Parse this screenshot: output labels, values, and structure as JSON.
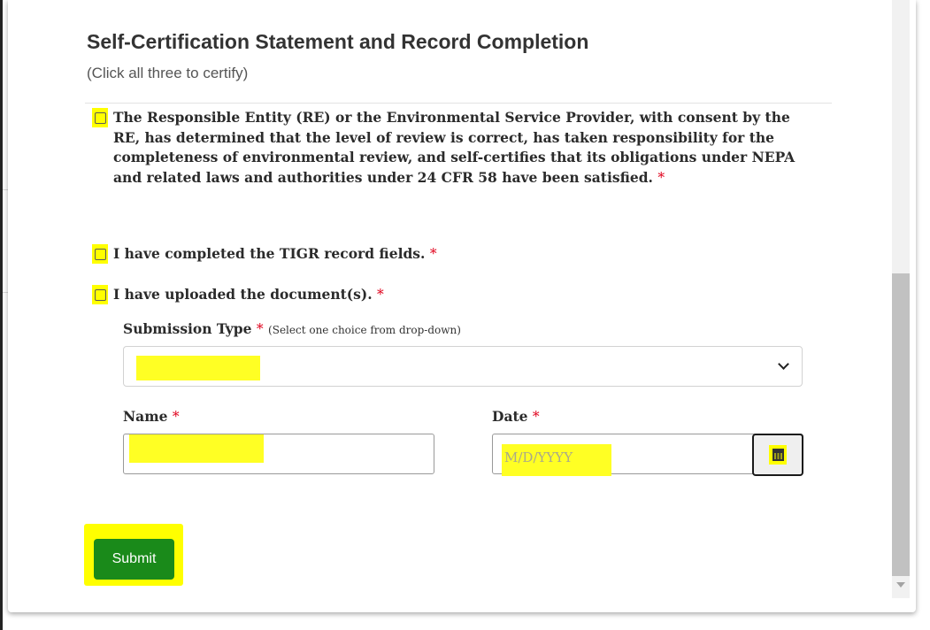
{
  "dialog": {
    "title": "Self-Certification Statement and Record Completion",
    "subtitle": "(Click all three to certify)"
  },
  "certifications": [
    {
      "text": "The Responsible Entity (RE) or the Environmental Service Provider, with consent by the RE, has determined that the level of review is correct, has taken responsibility for the completeness of environmental review, and self-certifies that its obligations under NEPA and related laws and authorities under 24 CFR 58 have been satisfied.",
      "required_mark": "*",
      "checked": false
    },
    {
      "text": "I have completed the TIGR record fields.",
      "required_mark": "*",
      "checked": false
    },
    {
      "text": "I have uploaded the document(s).",
      "required_mark": "*",
      "checked": false
    }
  ],
  "form": {
    "submission_type": {
      "label": "Submission Type",
      "required_mark": "*",
      "hint": "(Select one choice from drop-down)",
      "value": ""
    },
    "name": {
      "label": "Name",
      "required_mark": "*",
      "value": ""
    },
    "date": {
      "label": "Date",
      "required_mark": "*",
      "placeholder": "M/D/YYYY",
      "value": ""
    },
    "submit_label": "Submit"
  },
  "colors": {
    "highlight": "#ffff00",
    "submit_bg": "#1a8a1a",
    "required": "#e0001b"
  },
  "icons": {
    "calendar": "calendar-icon",
    "dropdown": "chevron-down-icon"
  }
}
